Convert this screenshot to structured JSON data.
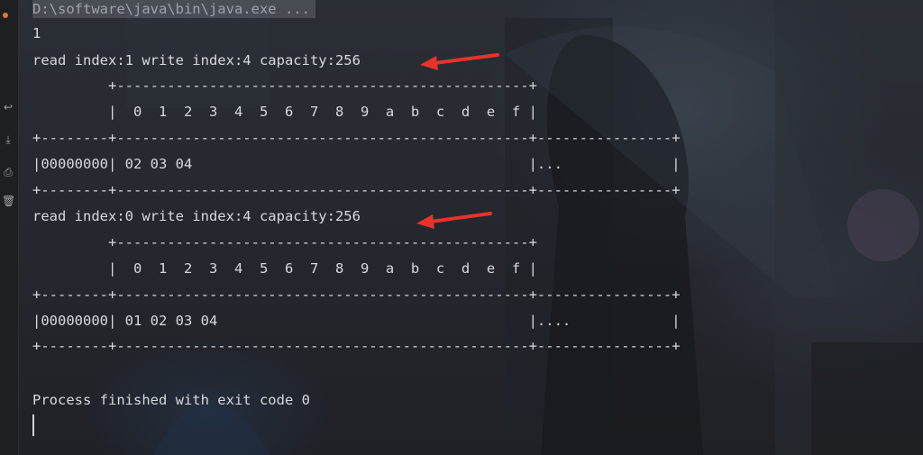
{
  "console": {
    "command": "D:\\software\\java\\bin\\java.exe ...",
    "lines": [
      "1",
      "read index:1 write index:4 capacity:256",
      "         +-------------------------------------------------+",
      "         |  0  1  2  3  4  5  6  7  8  9  a  b  c  d  e  f |",
      "+--------+-------------------------------------------------+----------------+",
      "|00000000| 02 03 04                                        |...             |",
      "+--------+-------------------------------------------------+----------------+",
      "read index:0 write index:4 capacity:256",
      "         +-------------------------------------------------+",
      "         |  0  1  2  3  4  5  6  7  8  9  a  b  c  d  e  f |",
      "+--------+-------------------------------------------------+----------------+",
      "|00000000| 01 02 03 04                                     |....            |",
      "+--------+-------------------------------------------------+----------------+",
      "Process finished with exit code 0"
    ]
  },
  "gutter": {
    "icons": [
      "soft-wrap-icon",
      "scroll-to-end-icon",
      "print-icon",
      "trash-icon"
    ]
  },
  "colors": {
    "arrow": "#e8322b",
    "text": "#d6d9dd",
    "background": "#24272d"
  }
}
